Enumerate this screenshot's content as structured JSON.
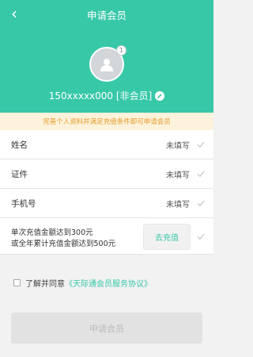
{
  "header": {
    "title": "申请会员",
    "back_icon": "‹",
    "bg_color": "#37c8a8"
  },
  "profile": {
    "avatar_badge": "1",
    "user_label": "150xxxxx000 [非会员]"
  },
  "notice": {
    "text": "完善个人资料并满足充值条件即可申请会员",
    "bg_color": "#fdf3dc",
    "text_color": "#e39b2a"
  },
  "fields": [
    {
      "label": "姓名",
      "value": "未填写"
    },
    {
      "label": "证件",
      "value": "未填写"
    },
    {
      "label": "手机号",
      "value": "未填写"
    }
  ],
  "recharge": {
    "line1": "单次充值金额达到300元",
    "line2": "或全年累计充值金额达到500元",
    "button_label": "去充值"
  },
  "agreement": {
    "prefix": "了解并同意",
    "link": "《天际通会员服务协议》",
    "checked": false
  },
  "apply_button": {
    "label": "申请会员",
    "enabled": false
  }
}
